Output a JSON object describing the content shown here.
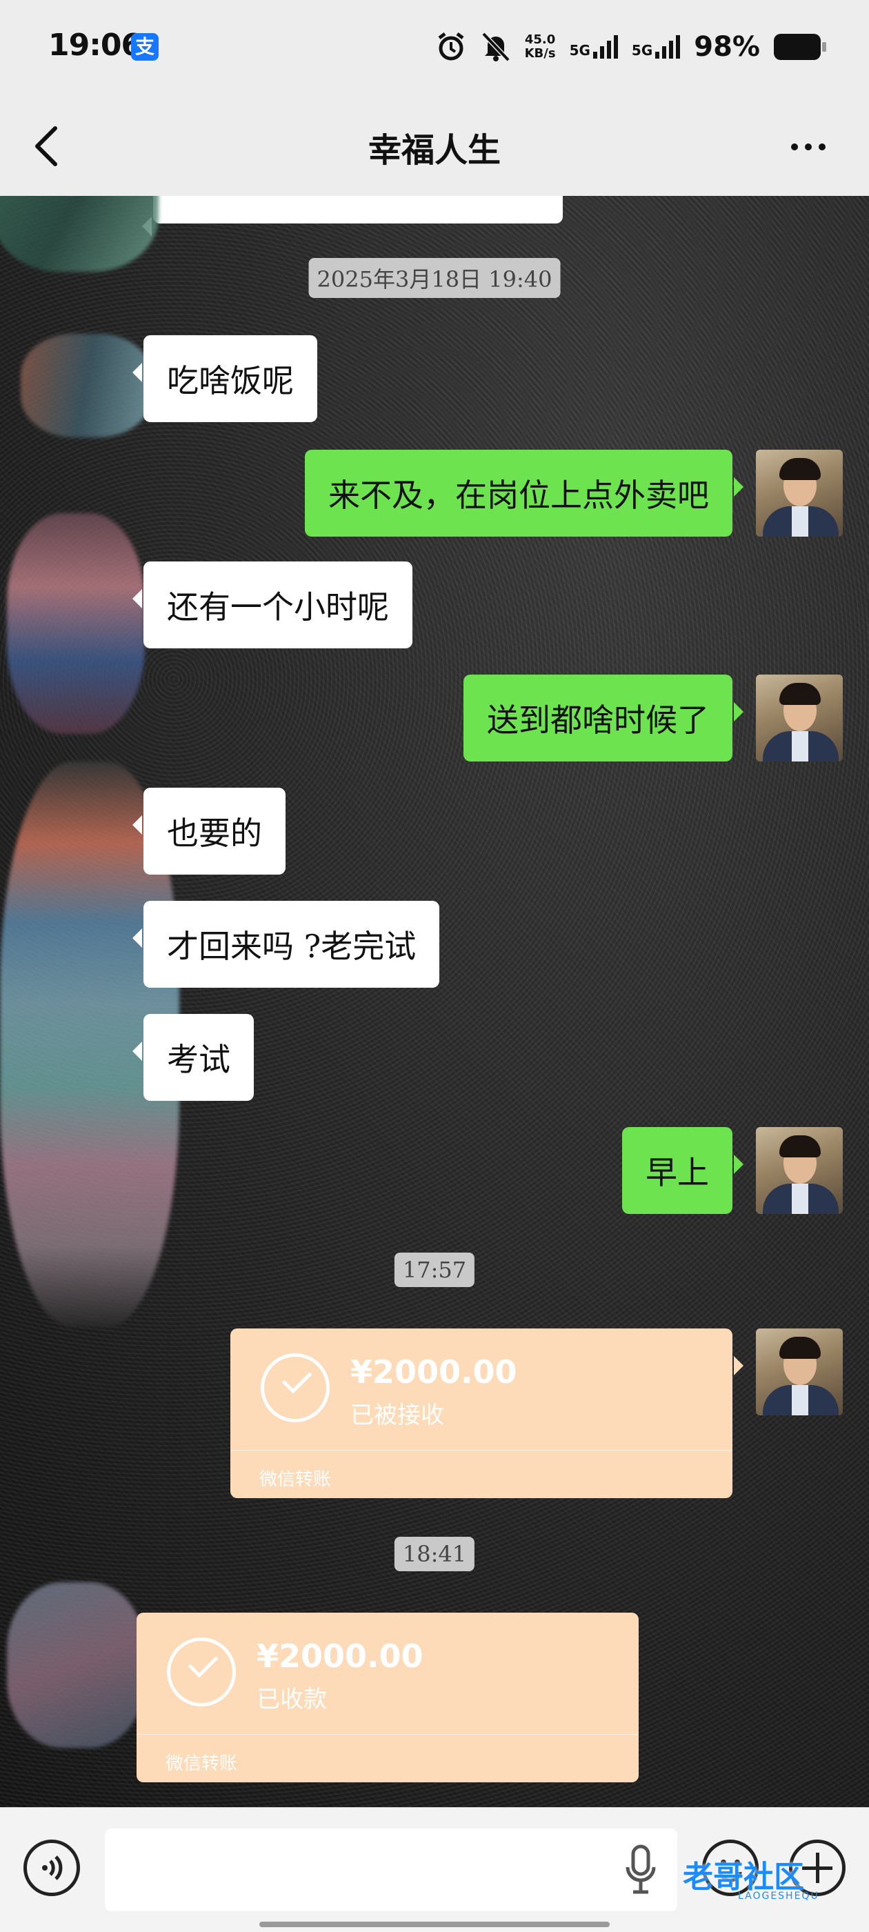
{
  "status_bar": {
    "time": "19:06",
    "alipay_icon": "支",
    "net_speed_value": "45.0",
    "net_speed_unit": "KB/s",
    "signal1_label": "5G",
    "signal2_label": "5G",
    "battery_text": "98%",
    "icons": [
      "alarm-icon",
      "mute-bell-icon",
      "signal-icon",
      "battery-icon"
    ]
  },
  "header": {
    "title": "幸福人生",
    "back_icon": "chevron-left-icon",
    "more_icon": "more-dots-icon"
  },
  "messages": [
    {
      "type": "timestamp",
      "text": "2025年3月18日 19:40"
    },
    {
      "type": "text",
      "from": "other",
      "text": "吃啥饭呢"
    },
    {
      "type": "text",
      "from": "me",
      "text": "来不及，在岗位上点外卖吧"
    },
    {
      "type": "text",
      "from": "other",
      "text": "还有一个小时呢"
    },
    {
      "type": "text",
      "from": "me",
      "text": "送到都啥时候了"
    },
    {
      "type": "text",
      "from": "other",
      "text": "也要的"
    },
    {
      "type": "text",
      "from": "other",
      "text": "才回来吗 ?老完试"
    },
    {
      "type": "text",
      "from": "other",
      "text": "考试"
    },
    {
      "type": "text",
      "from": "me",
      "text": "早上"
    },
    {
      "type": "timestamp",
      "text": "17:57"
    },
    {
      "type": "transfer",
      "from": "me",
      "amount": "¥2000.00",
      "status": "已被接收",
      "footer": "微信转账"
    },
    {
      "type": "timestamp",
      "text": "18:41"
    },
    {
      "type": "transfer",
      "from": "other",
      "amount": "¥2000.00",
      "status": "已收款",
      "footer": "微信转账"
    }
  ],
  "input_bar": {
    "placeholder": "",
    "icons": [
      "voice-icon",
      "mic-icon",
      "emoji-icon",
      "plus-icon"
    ],
    "watermark": "老哥社区",
    "watermark_sub": "LAOGESHEQU"
  },
  "colors": {
    "outgoing_bubble": "#6de34f",
    "incoming_bubble": "#ffffff",
    "transfer_card": "#fddbb8",
    "header_bg": "#ededed"
  }
}
